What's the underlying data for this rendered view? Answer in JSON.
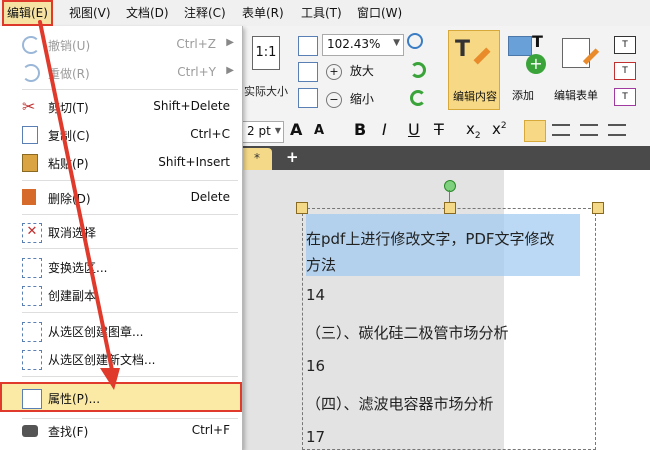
{
  "menubar": {
    "items": [
      "编辑(E)",
      "视图(V)",
      "文档(D)",
      "注释(C)",
      "表单(R)",
      "工具(T)",
      "窗口(W)"
    ]
  },
  "edit_menu": {
    "undo": {
      "label": "撤销(U)",
      "shortcut": "Ctrl+Z"
    },
    "redo": {
      "label": "重做(R)",
      "shortcut": "Ctrl+Y"
    },
    "cut": {
      "label": "剪切(T)",
      "shortcut": "Shift+Delete"
    },
    "copy": {
      "label": "复制(C)",
      "shortcut": "Ctrl+C"
    },
    "paste": {
      "label": "粘贴(P)",
      "shortcut": "Shift+Insert"
    },
    "delete": {
      "label": "删除(D)",
      "shortcut": "Delete"
    },
    "deselect": {
      "label": "取消选择"
    },
    "transform_selection": {
      "label": "变换选区..."
    },
    "create_copy": {
      "label": "创建副本"
    },
    "create_image_from_selection": {
      "label": "从选区创建图章..."
    },
    "create_document_from_selection": {
      "label": "从选区创建新文档..."
    },
    "properties": {
      "label": "属性(P)..."
    },
    "find": {
      "label": "查找(F)",
      "shortcut": "Ctrl+F"
    }
  },
  "toolbar": {
    "actual_size": "实际大小",
    "zoom_value": "102.43%",
    "zoom_in": "放大",
    "zoom_out": "缩小",
    "edit_content": "编辑内容",
    "add": "添加",
    "edit_form": "编辑表单",
    "font_size": "2 pt",
    "tab_close": "*",
    "tab_add": "+"
  },
  "document": {
    "selected_line1": "在pdf上进行修改文字，PDF文字修改",
    "selected_line2": "方法",
    "lines": [
      "14",
      "（三）、碳化硅二极管市场分析",
      "16",
      "（四）、滤波电容器市场分析",
      "17"
    ]
  },
  "colors": {
    "highlight": "#fbe9a6",
    "annotation_red": "#e03a2c",
    "selection_blue": "#9ec9f0"
  }
}
